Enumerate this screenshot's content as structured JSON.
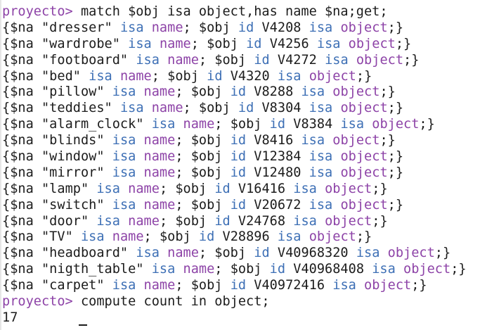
{
  "terminal": {
    "prompt": "proyecto>",
    "query_command": " match $obj isa object,has name $na;get;",
    "compute_command": " compute count in object;",
    "count_result": "17",
    "colors": {
      "prompt": "#8d43a7",
      "keyword": "#3d6fb5",
      "text": "#1c1c1c"
    },
    "results": [
      {
        "name": "\"dresser\"",
        "id": "V4208"
      },
      {
        "name": "\"wardrobe\"",
        "id": "V4256"
      },
      {
        "name": "\"footboard\"",
        "id": "V4272"
      },
      {
        "name": "\"bed\"",
        "id": "V4320"
      },
      {
        "name": "\"pillow\"",
        "id": "V8288"
      },
      {
        "name": "\"teddies\"",
        "id": "V8304"
      },
      {
        "name": "\"alarm_clock\"",
        "id": "V8384"
      },
      {
        "name": "\"blinds\"",
        "id": "V8416"
      },
      {
        "name": "\"window\"",
        "id": "V12384"
      },
      {
        "name": "\"mirror\"",
        "id": "V12480"
      },
      {
        "name": "\"lamp\"",
        "id": "V16416"
      },
      {
        "name": "\"switch\"",
        "id": "V20672"
      },
      {
        "name": "\"door\"",
        "id": "V24768"
      },
      {
        "name": "\"TV\"",
        "id": "V28896"
      },
      {
        "name": "\"headboard\"",
        "id": "V40968320"
      },
      {
        "name": "\"nigth_table\"",
        "id": "V40968408"
      },
      {
        "name": "\"carpet\"",
        "id": "V40972416"
      }
    ],
    "tokens": {
      "open": "{",
      "na_var": "$na ",
      "isa": "isa",
      "name_type": "name",
      "sep": "; ",
      "obj_var": "$obj ",
      "id_kw": "id",
      "object_type": "object",
      "close": ";}"
    }
  }
}
